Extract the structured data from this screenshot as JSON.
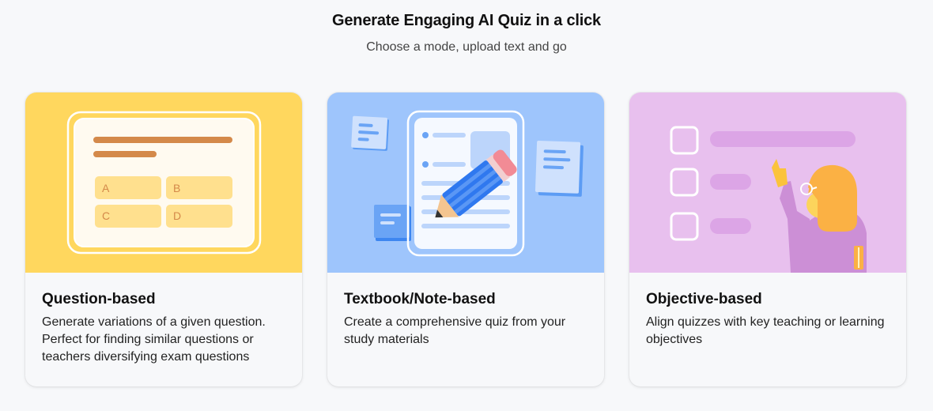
{
  "header": {
    "title": "Generate Engaging AI Quiz in a click",
    "subtitle": "Choose a mode, upload text and go"
  },
  "cards": [
    {
      "title": "Question-based",
      "description": "Generate variations of a given question. Perfect for finding similar questions or teachers diversifying exam questions",
      "illustration": "quiz-options-icon",
      "bg_color": "#ffd75e",
      "options": [
        "A",
        "B",
        "C",
        "D"
      ]
    },
    {
      "title": "Textbook/Note-based",
      "description": "Create a comprehensive quiz from your study materials",
      "illustration": "notes-pencil-icon",
      "bg_color": "#9ec5fc"
    },
    {
      "title": "Objective-based",
      "description": "Align quizzes with key teaching or learning objectives",
      "illustration": "teacher-checklist-icon",
      "bg_color": "#e8c0ee"
    }
  ]
}
